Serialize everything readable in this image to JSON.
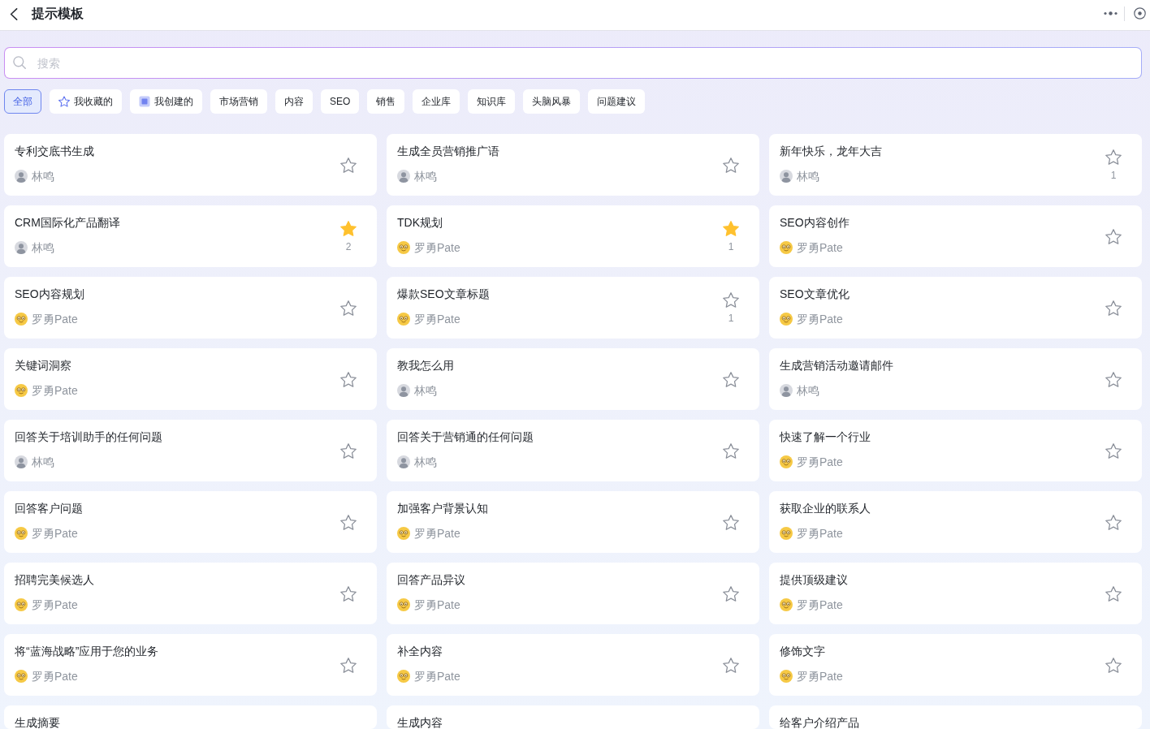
{
  "header": {
    "title": "提示模板"
  },
  "search": {
    "placeholder": "搜索"
  },
  "filters": [
    {
      "label": "全部",
      "selected": true,
      "kind": "text"
    },
    {
      "label": "我收藏的",
      "selected": false,
      "kind": "favorites"
    },
    {
      "label": "我创建的",
      "selected": false,
      "kind": "mine"
    },
    {
      "label": "市场营销",
      "selected": false,
      "kind": "text"
    },
    {
      "label": "内容",
      "selected": false,
      "kind": "text"
    },
    {
      "label": "SEO",
      "selected": false,
      "kind": "text"
    },
    {
      "label": "销售",
      "selected": false,
      "kind": "text"
    },
    {
      "label": "企业库",
      "selected": false,
      "kind": "text"
    },
    {
      "label": "知识库",
      "selected": false,
      "kind": "text"
    },
    {
      "label": "头脑风暴",
      "selected": false,
      "kind": "text"
    },
    {
      "label": "问题建议",
      "selected": false,
      "kind": "text"
    }
  ],
  "cards": [
    {
      "title": "专利交底书生成",
      "author": {
        "name": "林鸣",
        "kind": "photo"
      },
      "favorited": false
    },
    {
      "title": "生成全员营销推广语",
      "author": {
        "name": "林鸣",
        "kind": "photo"
      },
      "favorited": false
    },
    {
      "title": "新年快乐，龙年大吉",
      "author": {
        "name": "林鸣",
        "kind": "photo"
      },
      "favorited": false,
      "favorite_count": "1"
    },
    {
      "title": "CRM国际化产品翻译",
      "author": {
        "name": "林鸣",
        "kind": "photo"
      },
      "favorited": true,
      "favorite_count": "2"
    },
    {
      "title": "TDK规划",
      "author": {
        "name": "罗勇Pate",
        "kind": "cartoon"
      },
      "favorited": true,
      "favorite_count": "1"
    },
    {
      "title": "SEO内容创作",
      "author": {
        "name": "罗勇Pate",
        "kind": "cartoon"
      },
      "favorited": false
    },
    {
      "title": "SEO内容规划",
      "author": {
        "name": "罗勇Pate",
        "kind": "cartoon"
      },
      "favorited": false
    },
    {
      "title": "爆款SEO文章标题",
      "author": {
        "name": "罗勇Pate",
        "kind": "cartoon"
      },
      "favorited": false,
      "favorite_count": "1"
    },
    {
      "title": "SEO文章优化",
      "author": {
        "name": "罗勇Pate",
        "kind": "cartoon"
      },
      "favorited": false
    },
    {
      "title": "关键词洞察",
      "author": {
        "name": "罗勇Pate",
        "kind": "cartoon"
      },
      "favorited": false
    },
    {
      "title": "教我怎么用",
      "author": {
        "name": "林鸣",
        "kind": "photo"
      },
      "favorited": false
    },
    {
      "title": "生成营销活动邀请邮件",
      "author": {
        "name": "林鸣",
        "kind": "photo"
      },
      "favorited": false
    },
    {
      "title": "回答关于培训助手的任何问题",
      "author": {
        "name": "林鸣",
        "kind": "photo"
      },
      "favorited": false
    },
    {
      "title": "回答关于营销通的任何问题",
      "author": {
        "name": "林鸣",
        "kind": "photo"
      },
      "favorited": false
    },
    {
      "title": "快速了解一个行业",
      "author": {
        "name": "罗勇Pate",
        "kind": "cartoon"
      },
      "favorited": false
    },
    {
      "title": "回答客户问题",
      "author": {
        "name": "罗勇Pate",
        "kind": "cartoon"
      },
      "favorited": false
    },
    {
      "title": "加强客户背景认知",
      "author": {
        "name": "罗勇Pate",
        "kind": "cartoon"
      },
      "favorited": false
    },
    {
      "title": "获取企业的联系人",
      "author": {
        "name": "罗勇Pate",
        "kind": "cartoon"
      },
      "favorited": false
    },
    {
      "title": "招聘完美候选人",
      "author": {
        "name": "罗勇Pate",
        "kind": "cartoon"
      },
      "favorited": false
    },
    {
      "title": "回答产品异议",
      "author": {
        "name": "罗勇Pate",
        "kind": "cartoon"
      },
      "favorited": false
    },
    {
      "title": "提供顶级建议",
      "author": {
        "name": "罗勇Pate",
        "kind": "cartoon"
      },
      "favorited": false
    },
    {
      "title": "将“蓝海战略”应用于您的业务",
      "author": {
        "name": "罗勇Pate",
        "kind": "cartoon"
      },
      "favorited": false
    },
    {
      "title": "补全内容",
      "author": {
        "name": "罗勇Pate",
        "kind": "cartoon"
      },
      "favorited": false
    },
    {
      "title": "修饰文字",
      "author": {
        "name": "罗勇Pate",
        "kind": "cartoon"
      },
      "favorited": false
    },
    {
      "title": "生成摘要"
    },
    {
      "title": "生成内容"
    },
    {
      "title": "给客户介绍产品"
    }
  ]
}
